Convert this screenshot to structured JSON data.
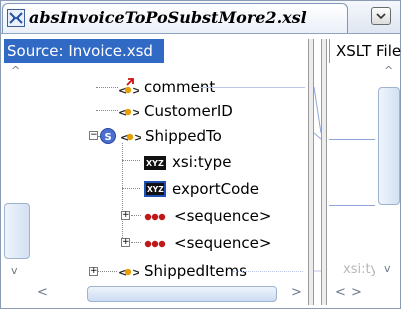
{
  "window": {
    "tab_title": "absInvoiceToPoSubstMore2.xsl",
    "tab_icon": "xslt-mapper-icon",
    "menu_icon": "chevron-down-icon"
  },
  "source": {
    "header": "Source: Invoice.xsd",
    "items": [
      {
        "label": "comment",
        "icon": "element-required-icon"
      },
      {
        "label": "CustomerID",
        "icon": "element-icon"
      },
      {
        "label": "ShippedTo",
        "icon": "element-icon",
        "badge": "S"
      },
      {
        "label": "xsi:type",
        "icon": "attribute-xyz-icon"
      },
      {
        "label": "exportCode",
        "icon": "attribute-xyz-icon"
      },
      {
        "label": "<sequence>",
        "icon": "sequence-icon"
      },
      {
        "label": "<sequence>",
        "icon": "sequence-icon"
      },
      {
        "label": "ShippedItems",
        "icon": "element-icon"
      }
    ]
  },
  "target": {
    "header": "XSLT File",
    "ghost_label": "xsi:ty"
  },
  "colors": {
    "selection": "#316ac5",
    "link_line": "#8fa6dd"
  }
}
